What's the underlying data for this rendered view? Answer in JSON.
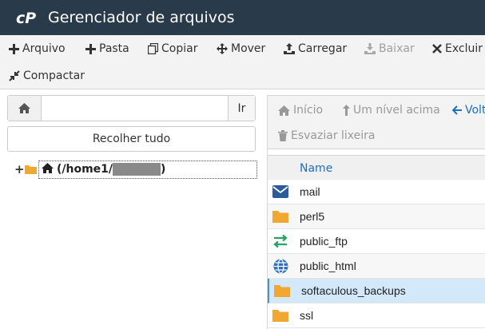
{
  "header": {
    "title": "Gerenciador de arquivos"
  },
  "toolbar": {
    "row1": [
      {
        "label": "Arquivo",
        "icon": "plus-icon"
      },
      {
        "label": "Pasta",
        "icon": "plus-icon"
      },
      {
        "label": "Copiar",
        "icon": "copy-icon"
      },
      {
        "label": "Mover",
        "icon": "move-arrows-icon"
      },
      {
        "label": "Carregar",
        "icon": "upload-icon"
      },
      {
        "label": "Baixar",
        "icon": "download-icon",
        "disabled": true
      },
      {
        "label": "Excluir",
        "icon": "close-icon"
      }
    ],
    "row2": [
      {
        "label": "Compactar",
        "icon": "compress-icon"
      }
    ]
  },
  "left": {
    "path_value": "",
    "go_label": "Ir",
    "collapse_label": "Recolher tudo",
    "tree_root_label": "(/home1/",
    "tree_root_suffix": ")"
  },
  "nav": {
    "home_label": "Início",
    "up_label": "Um nível acima",
    "back_label": "Volt",
    "trash_label": "Esvaziar lixeira"
  },
  "table": {
    "name_header": "Name",
    "files": [
      {
        "name": "mail",
        "icon": "mail-icon"
      },
      {
        "name": "perl5",
        "icon": "folder-icon"
      },
      {
        "name": "public_ftp",
        "icon": "transfer-arrows-icon"
      },
      {
        "name": "public_html",
        "icon": "globe-icon"
      },
      {
        "name": "softaculous_backups",
        "icon": "folder-icon",
        "selected": true
      },
      {
        "name": "ssl",
        "icon": "folder-icon"
      }
    ]
  },
  "colors": {
    "header_bg": "#293a4a",
    "link_blue": "#1a6fc0",
    "folder_orange": "#f0a830",
    "selected_row": "#d3e8f8"
  }
}
